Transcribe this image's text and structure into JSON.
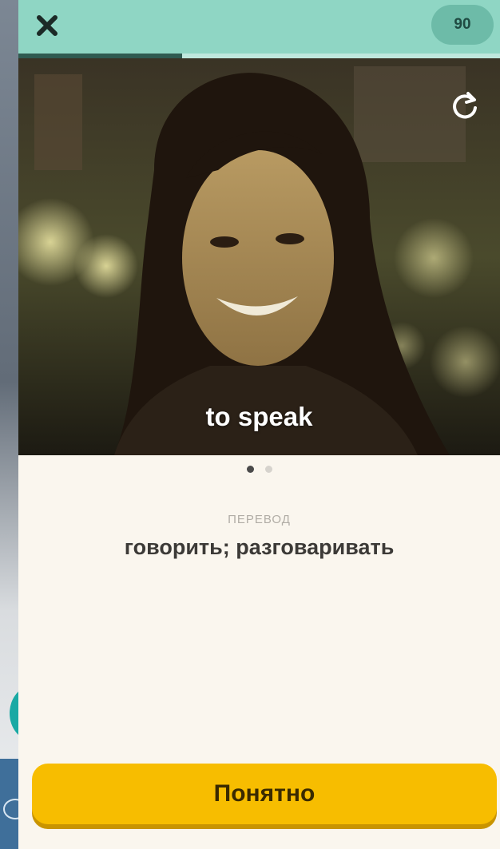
{
  "header": {
    "close_icon": "close-icon",
    "score": "90",
    "progress_fraction": 0.34,
    "accent_color": "#8fd6c4"
  },
  "card": {
    "replay_icon": "replay-icon",
    "word": "to speak",
    "slides_total": 2,
    "slide_active": 1
  },
  "translation": {
    "label": "ПЕРЕВОД",
    "text": "говорить; разговаривать"
  },
  "footer": {
    "button_label": "Понятно",
    "button_color": "#f7bd00"
  }
}
